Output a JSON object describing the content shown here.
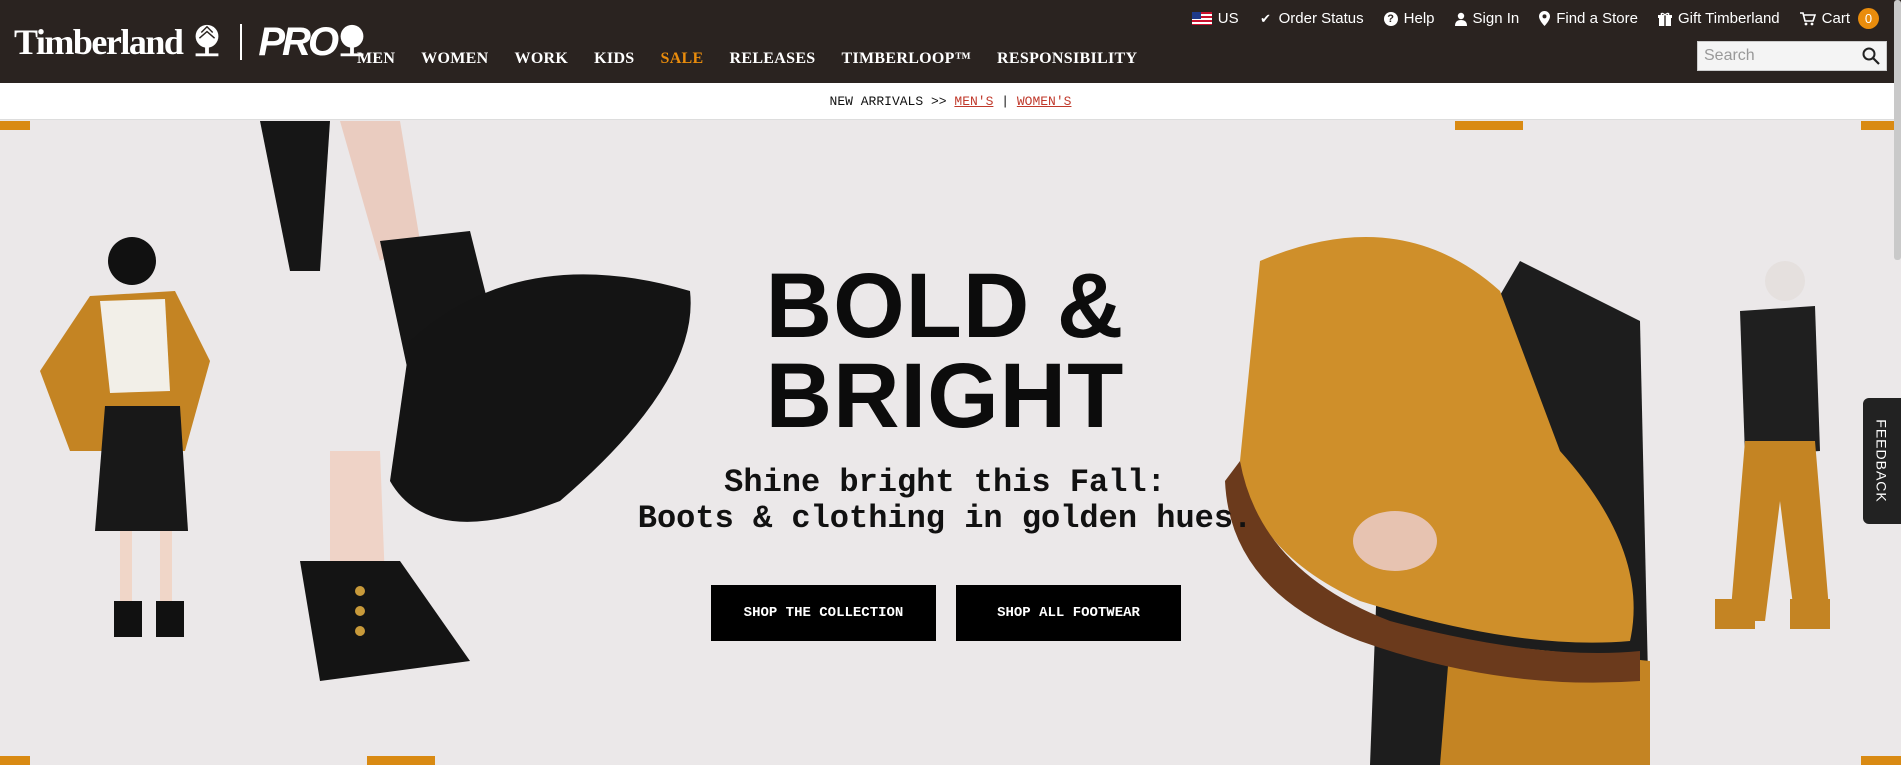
{
  "brand": {
    "name": "Timberland",
    "pro": "PRO"
  },
  "utility_nav": {
    "country": "US",
    "order_status": "Order Status",
    "help": "Help",
    "sign_in": "Sign In",
    "find_store": "Find a Store",
    "gift": "Gift Timberland",
    "cart": "Cart",
    "cart_count": "0"
  },
  "main_nav": [
    "MEN",
    "WOMEN",
    "WORK",
    "KIDS",
    "SALE",
    "RELEASES",
    "TIMBERLOOP™",
    "RESPONSIBILITY"
  ],
  "search": {
    "placeholder": "Search"
  },
  "promo": {
    "prefix": "NEW ARRIVALS >>",
    "mens": "MEN'S",
    "separator": "|",
    "womens": "WOMEN'S"
  },
  "hero": {
    "title_line1": "BOLD &",
    "title_line2": "BRIGHT",
    "subtitle_line1": "Shine bright this Fall:",
    "subtitle_line2": "Boots & clothing in golden hues.",
    "cta_primary": "SHOP THE COLLECTION",
    "cta_secondary": "SHOP ALL FOOTWEAR"
  },
  "feedback": "FEEDBACK",
  "colors": {
    "header_bg": "#2a2320",
    "sale": "#e98c0c",
    "accent_gold": "#d98a13",
    "promo_link": "#c0392b",
    "hero_bg": "#ebe8e9"
  }
}
